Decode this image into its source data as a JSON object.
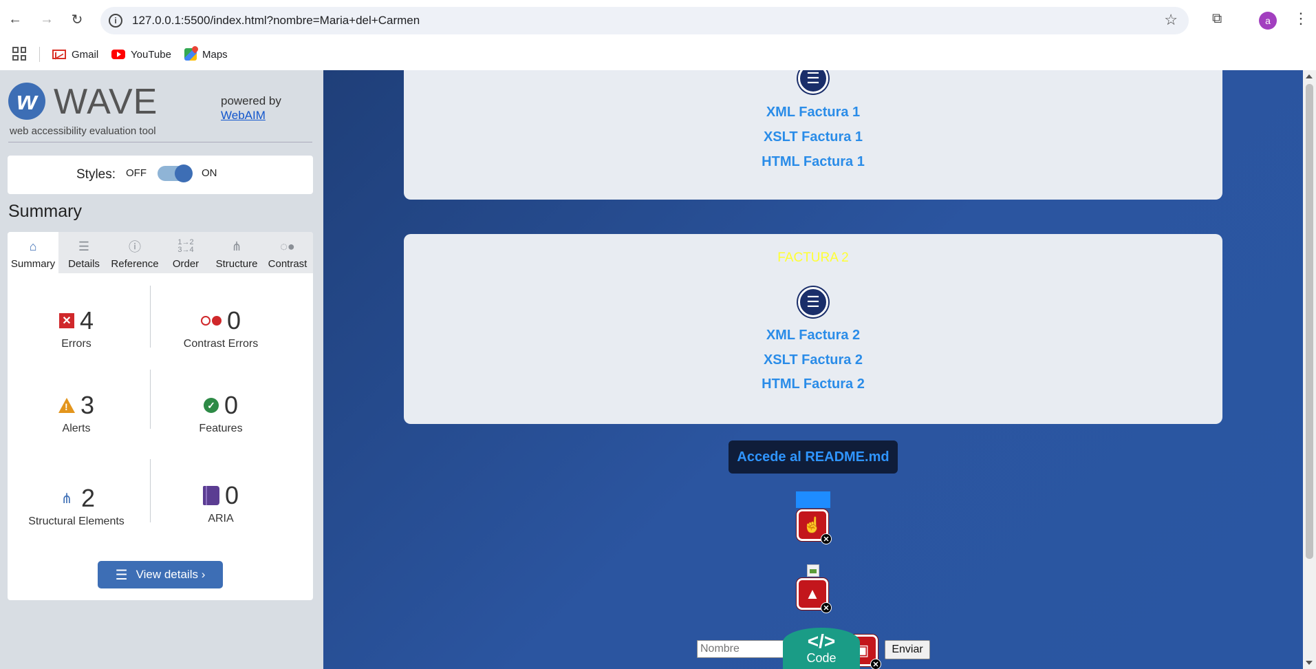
{
  "browser": {
    "url": "127.0.0.1:5500/index.html?nombre=Maria+del+Carmen",
    "avatar_letter": "a",
    "bookmarks": [
      {
        "label": "Gmail",
        "icon": "gmail-icon"
      },
      {
        "label": "YouTube",
        "icon": "youtube-icon"
      },
      {
        "label": "Maps",
        "icon": "maps-icon"
      }
    ]
  },
  "wave": {
    "title": "WAVE",
    "subtitle": "web accessibility evaluation tool",
    "powered_by": "powered by",
    "webaim_link": "WebAIM",
    "styles_label": "Styles:",
    "styles_off": "OFF",
    "styles_on": "ON",
    "styles_state": "on",
    "summary_title": "Summary",
    "tabs": [
      {
        "label": "Summary",
        "icon": "home-icon",
        "active": true
      },
      {
        "label": "Details",
        "icon": "list-icon",
        "active": false
      },
      {
        "label": "Reference",
        "icon": "info-icon",
        "active": false
      },
      {
        "label": "Order",
        "icon": "order-icon",
        "active": false
      },
      {
        "label": "Structure",
        "icon": "structure-icon",
        "active": false
      },
      {
        "label": "Contrast",
        "icon": "contrast-icon",
        "active": false
      }
    ],
    "stats": {
      "errors": {
        "count": "4",
        "label": "Errors"
      },
      "contrast_errors": {
        "count": "0",
        "label": "Contrast Errors"
      },
      "alerts": {
        "count": "3",
        "label": "Alerts"
      },
      "features": {
        "count": "0",
        "label": "Features"
      },
      "structural": {
        "count": "2",
        "label": "Structural Elements"
      },
      "aria": {
        "count": "0",
        "label": "ARIA"
      }
    },
    "view_details": "View details ›",
    "colors": {
      "accent": "#3d6eb5",
      "error": "#d0282b",
      "alert": "#e3951c",
      "feature": "#2d8a46",
      "aria": "#5b3d92"
    }
  },
  "page": {
    "card1": {
      "links": [
        "XML Factura 1",
        "XSLT Factura 1",
        "HTML Factura 1"
      ]
    },
    "card2": {
      "title": "FACTURA 2",
      "links": [
        "XML Factura 2",
        "XSLT Factura 2",
        "HTML Factura 2"
      ]
    },
    "readme_link": "Accede al README.md",
    "name_placeholder": "Nombre",
    "code_label": "Code",
    "code_glyph": "</>",
    "submit_label": "Enviar"
  }
}
